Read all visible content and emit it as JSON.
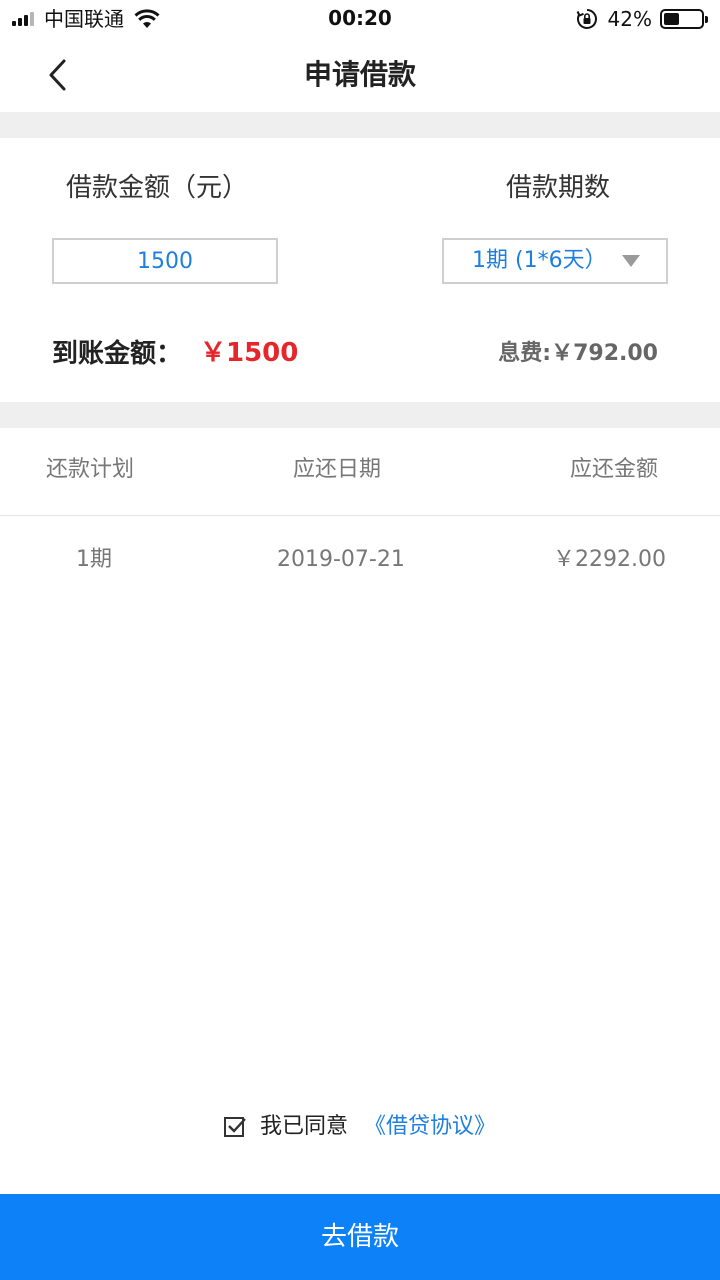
{
  "status_bar": {
    "carrier": "中国联通",
    "time": "00:20",
    "battery_percent": "42%",
    "battery_level": 0.42,
    "icons": [
      "signal-icon",
      "wifi-icon",
      "rotation-lock-icon",
      "battery-icon"
    ]
  },
  "nav": {
    "title": "申请借款",
    "back_icon": "chevron-left-icon"
  },
  "loan_form": {
    "amount_label": "借款金额（元）",
    "amount_value": "1500",
    "term_label": "借款期数",
    "term_value": "1期 (1*6天）",
    "term_dropdown_icon": "triangle-down-icon",
    "received_label": "到账金额：",
    "received_value": "￥1500",
    "fee_text": "息费:￥792.00"
  },
  "repayment_table": {
    "headers": [
      "还款计划",
      "应还日期",
      "应还金额"
    ],
    "rows": [
      [
        "1期",
        "2019-07-21",
        "￥2292.00"
      ]
    ]
  },
  "agreement": {
    "checked": true,
    "text": "我已同意",
    "link": "《借贷协议》"
  },
  "submit_label": "去借款",
  "colors": {
    "accent_blue": "#0d81f7",
    "link_blue": "#1e7fe0",
    "amount_red": "#e5262b",
    "band_gray": "#efefef"
  }
}
